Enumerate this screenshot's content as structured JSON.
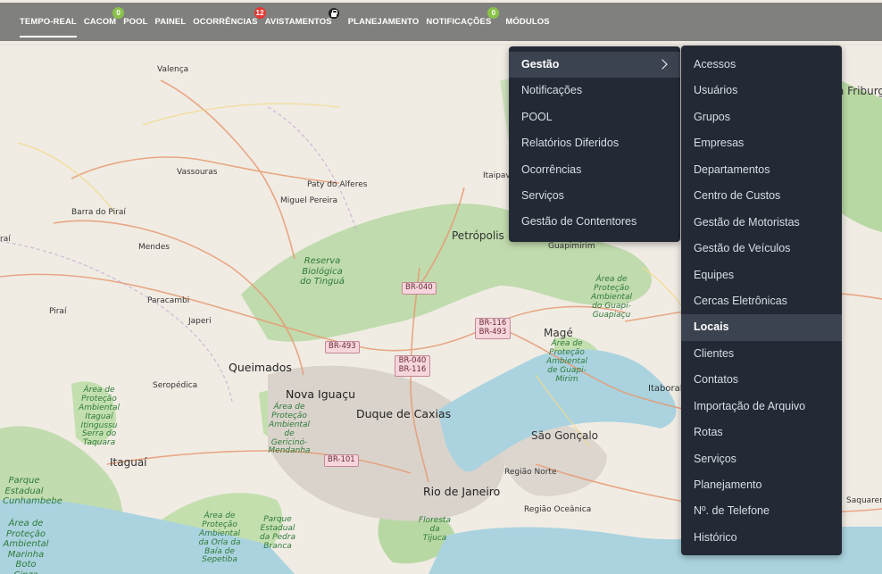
{
  "nav": {
    "items": [
      {
        "label": "TEMPO-REAL",
        "active": true
      },
      {
        "label": "CACOM",
        "badge": "0",
        "badge_color": "#8bc34a"
      },
      {
        "label": "POOL"
      },
      {
        "label": "PAINEL"
      },
      {
        "label": "OCORRÊNCIAS",
        "badge": "12",
        "badge_color": "#e53935"
      },
      {
        "label": "AVISTAMENTOS",
        "icon": "lock-icon"
      },
      {
        "label": "PLANEJAMENTO"
      },
      {
        "label": "NOTIFICAÇÕES",
        "badge": "0",
        "badge_color": "#8bc34a"
      },
      {
        "label": "MÓDULOS"
      }
    ]
  },
  "menu_main": {
    "items": [
      "Gestão",
      "Notificações",
      "POOL",
      "Relatórios Diferidos",
      "Ocorrências",
      "Serviços",
      "Gestão de Contentores"
    ],
    "selected": "Gestão"
  },
  "menu_sub": {
    "items": [
      "Acessos",
      "Usuários",
      "Grupos",
      "Empresas",
      "Departamentos",
      "Centro de Custos",
      "Gestão de Motoristas",
      "Gestão de Veículos",
      "Equipes",
      "Cercas Eletrônicas",
      "Locais",
      "Clientes",
      "Contatos",
      "Importação de Arquivo",
      "Rotas",
      "Serviços",
      "Planejamento",
      "Nº. de Telefone",
      "Histórico"
    ],
    "selected": "Locais"
  },
  "map": {
    "labels": {
      "valenca": "Valença",
      "vassouras": "Vassouras",
      "paty": "Paty do Alferes",
      "miguel": "Miguel Pereira",
      "barra": "Barra do Piraí",
      "mendes": "Mendes",
      "pirai": "Piraí",
      "rai": "raí",
      "paracambi": "Paracambi",
      "japeri": "Japeri",
      "queimados": "Queimados",
      "seropedica": "Seropédica",
      "nova_iguacu": "Nova Iguaçu",
      "duque": "Duque de Caxias",
      "itaguai": "Itaguaí",
      "rio": "Rio de Janeiro",
      "sao_goncalo": "São Gonçalo",
      "mage": "Magé",
      "petropolis": "Petrópolis",
      "guapimirim": "Guapimirim",
      "itaboral": "Itaboral",
      "regiao_norte": "Região Norte",
      "regiao_oceanica": "Região Oceânica",
      "saquarema": "Saquaren",
      "itaipava": "Itaipava",
      "friburgo": "a Friburg",
      "reserva": "Reserva Biológica do Tinguá",
      "apa_petropolis": "Área de Proteção Ambiental do Guapi-Guapiaçu",
      "apa_guapi": "Área de Proteção Ambiental de Guapi-Mirim",
      "apa_itaguai": "Área de Proteção Ambiental Itaguaí Itingussu Serra do Taquara",
      "apa_gericino": "Área de Proteção Ambiental de Gericinó-Mendanha",
      "parque_estadual": "Parque Estadual Cunhambebe",
      "apa_marinha": "Área de Proteção Ambiental Marinha Boto Cinza",
      "apa_orla": "Área de Proteção Ambiental da Orla da Baía de Sepetiba",
      "parque_pedra": "Parque Estadual da Pedra Branca",
      "floresta": "Floresta da Tijuca"
    },
    "shields": {
      "br040": "BR-040",
      "br116_493": "BR-116 BR-493",
      "br493": "BR-493",
      "br040_116": "BR-040 BR-116",
      "br101": "BR-101"
    }
  }
}
